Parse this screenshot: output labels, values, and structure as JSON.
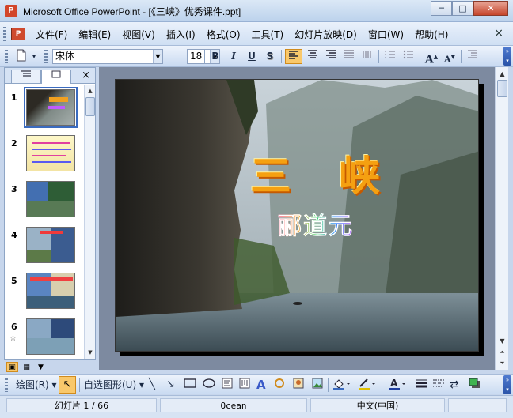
{
  "window": {
    "title": "Microsoft Office PowerPoint - [《三峡》优秀课件.ppt]",
    "app_icon_label": "P",
    "minimize": "─",
    "maximize": "□",
    "close": "✕"
  },
  "menu": {
    "items": [
      "文件(F)",
      "编辑(E)",
      "视图(V)",
      "插入(I)",
      "格式(O)",
      "工具(T)",
      "幻灯片放映(D)",
      "窗口(W)",
      "帮助(H)"
    ],
    "close": "×"
  },
  "toolbar": {
    "font_name": "宋体",
    "font_size": "18",
    "bold": "B",
    "italic": "I",
    "underline": "U",
    "shadow": "S",
    "increase_font": "A",
    "decrease_font": "A"
  },
  "slides_pane": {
    "slides": [
      {
        "number": "1",
        "selected": true
      },
      {
        "number": "2",
        "selected": false
      },
      {
        "number": "3",
        "selected": false
      },
      {
        "number": "4",
        "selected": false
      },
      {
        "number": "5",
        "selected": false
      },
      {
        "number": "6",
        "selected": false,
        "star": "☆"
      }
    ],
    "close": "×"
  },
  "slide": {
    "title": "三峡",
    "subtitle": "郦道元"
  },
  "drawing_toolbar": {
    "draw_label": "绘图(R) ▾",
    "autoshapes_label": "自选图形(U) ▾"
  },
  "status": {
    "slide_counter": "幻灯片 1 / 66",
    "template": "Ocean",
    "language": "中文(中国)"
  },
  "colors": {
    "title_orange": "#f5a011",
    "toolbar_blue": "#c9daf1",
    "selected_button": "#f9c86b"
  }
}
